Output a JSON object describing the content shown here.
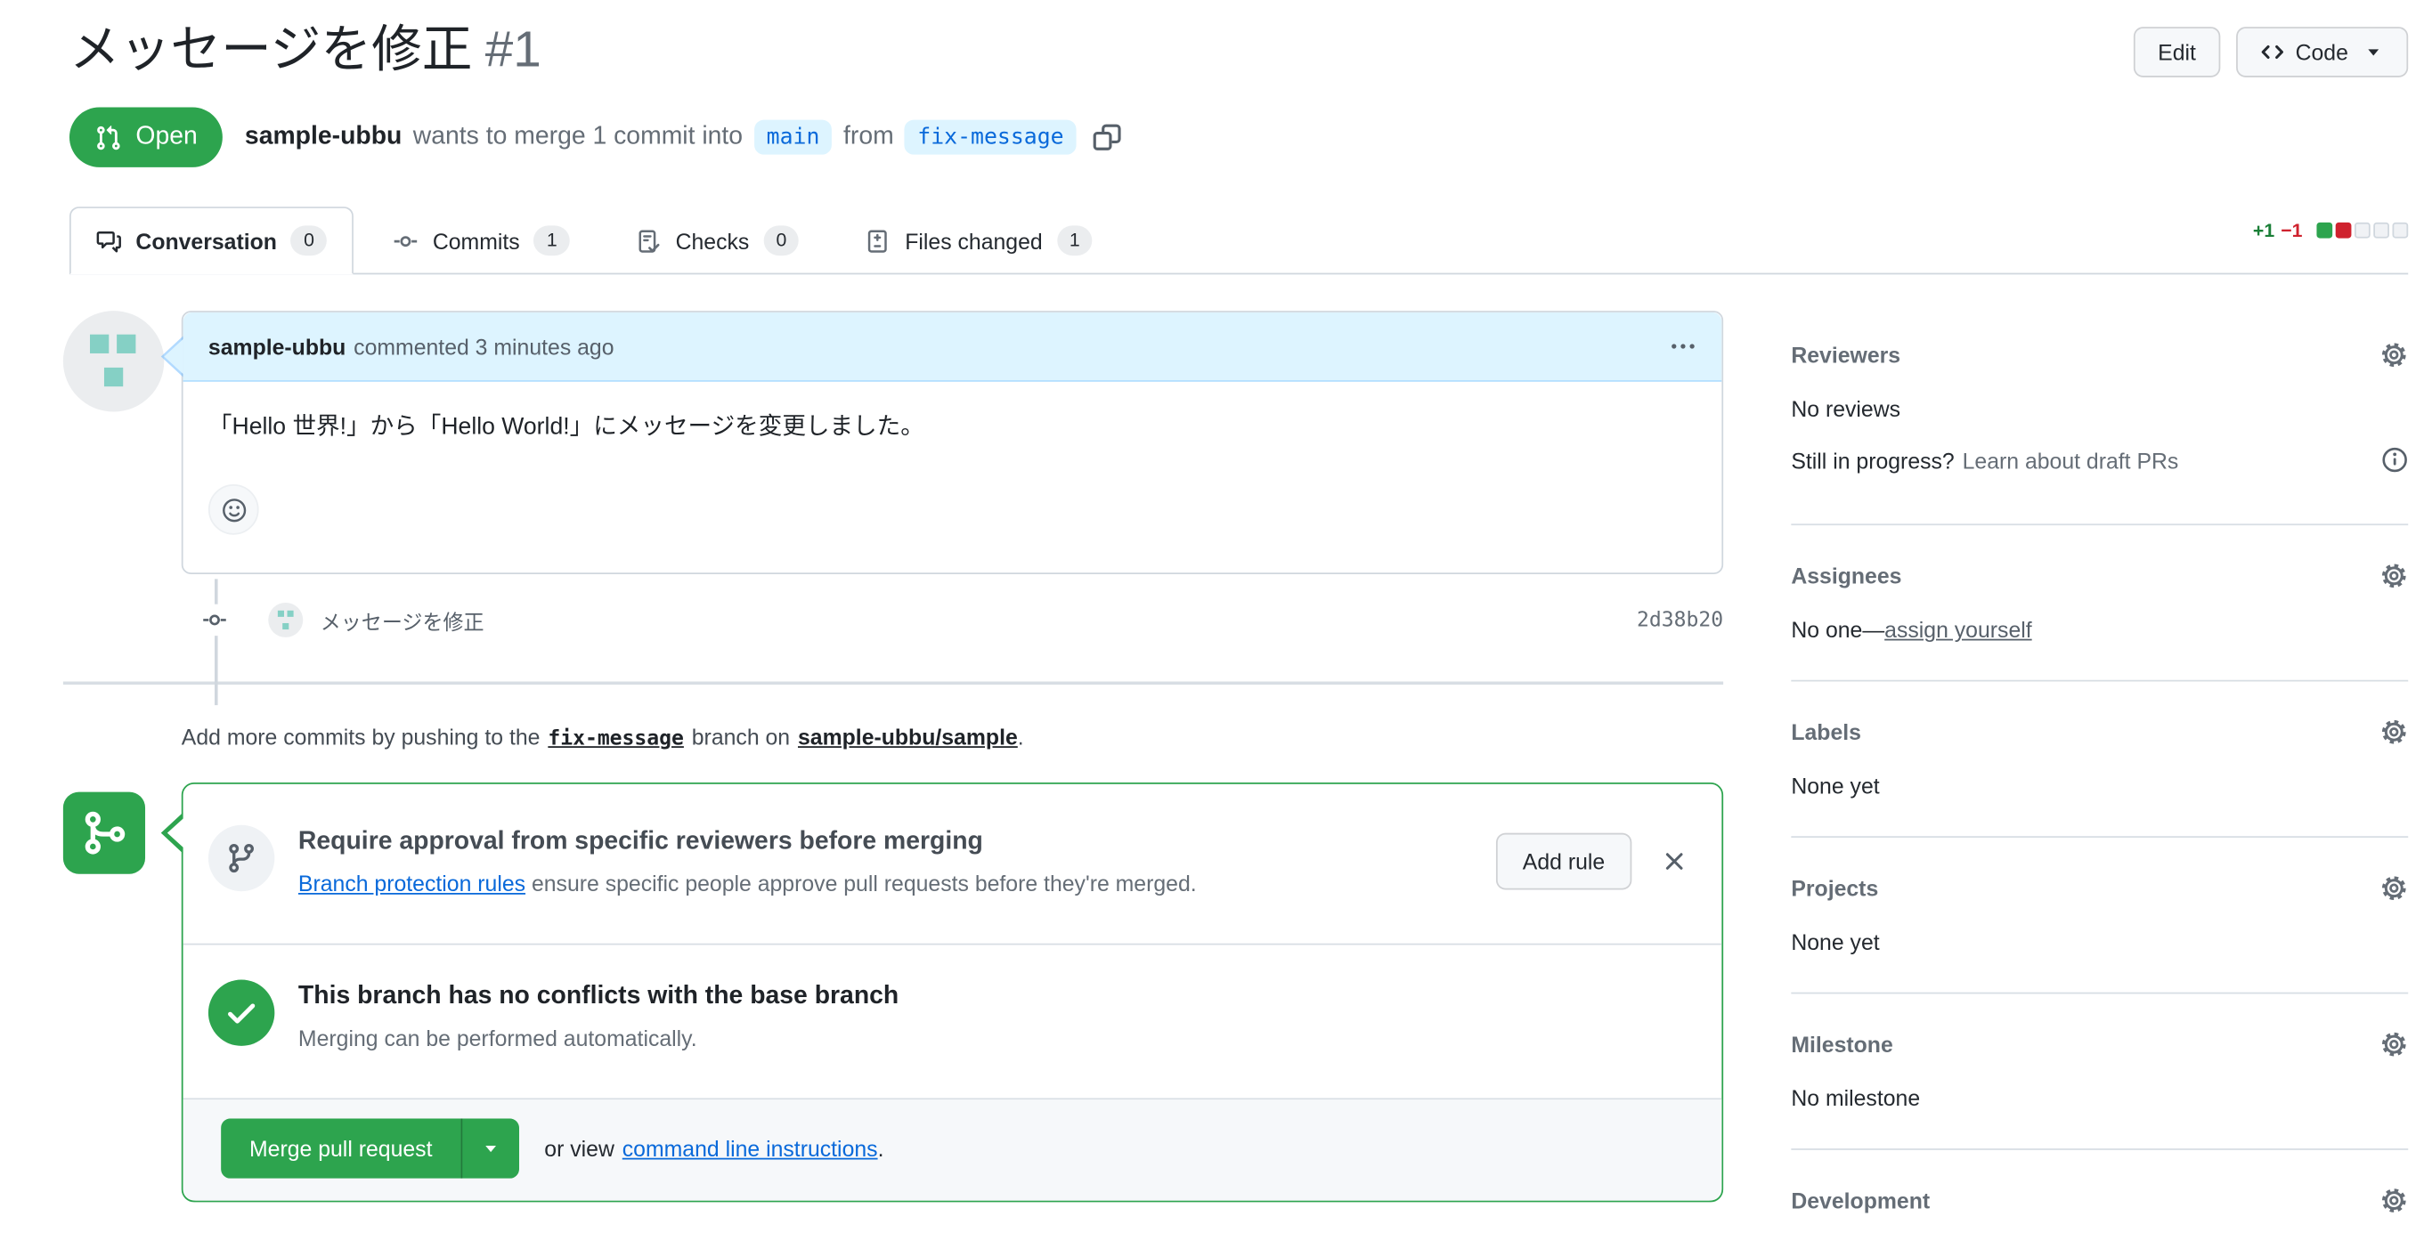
{
  "colors": {
    "open_green": "#2da44e",
    "link_blue": "#0969da",
    "addition_green": "#1a7f37",
    "deletion_red": "#cf222e",
    "branch_chip_bg": "#ddf4ff",
    "comment_header_bg": "#ddf4ff",
    "identicon_teal": "#85d0c5"
  },
  "icons": {
    "state": "git-pull-request",
    "code_button": "code",
    "dropdown": "triangle-down",
    "tab_conversation": "comment-discussion",
    "tab_commits": "git-commit",
    "tab_checks": "checklist",
    "tab_files": "file-diff",
    "copy": "copy",
    "comment_menu": "kebab-horizontal",
    "reaction": "smiley",
    "timeline_commit": "git-commit",
    "merge_badge": "git-merge",
    "branch_protection": "git-branch",
    "merge_check": "check",
    "close": "x",
    "section_settings": "gear",
    "draft_info": "info"
  },
  "header": {
    "title": "メッセージを修正",
    "number": "#1",
    "edit_label": "Edit",
    "code_label": "Code"
  },
  "meta": {
    "state": "Open",
    "author": "sample-ubbu",
    "action": "wants to merge 1 commit into",
    "base_branch": "main",
    "from_word": "from",
    "head_branch": "fix-message"
  },
  "tabs": [
    {
      "label": "Conversation",
      "count": "0"
    },
    {
      "label": "Commits",
      "count": "1"
    },
    {
      "label": "Checks",
      "count": "0"
    },
    {
      "label": "Files changed",
      "count": "1"
    }
  ],
  "diffstat": {
    "additions": "+1",
    "deletions": "−1"
  },
  "comment": {
    "author": "sample-ubbu",
    "meta": "commented 3 minutes ago",
    "body": "「Hello 世界!」から「Hello World!」にメッセージを変更しました。"
  },
  "commit": {
    "message": "メッセージを修正",
    "sha": "2d38b20"
  },
  "push_note": {
    "prefix": "Add more commits by pushing to the",
    "branch": "fix-message",
    "middle": "branch on",
    "repo": "sample-ubbu/sample",
    "suffix": "."
  },
  "merge_box": {
    "rule_title": "Require approval from specific reviewers before merging",
    "rule_link": "Branch protection rules",
    "rule_rest": "ensure specific people approve pull requests before they're merged.",
    "add_rule_label": "Add rule",
    "status_title": "This branch has no conflicts with the base branch",
    "status_subtitle": "Merging can be performed automatically.",
    "merge_button_label": "Merge pull request",
    "or_view": "or view",
    "cli_link": "command line instructions",
    "period": "."
  },
  "sidebar": {
    "sections": [
      {
        "title": "Reviewers",
        "body": "No reviews",
        "note_prefix": "Still in progress?",
        "note_link": "Learn about draft PRs"
      },
      {
        "title": "Assignees",
        "body_prefix": "No one—",
        "body_link": "assign yourself"
      },
      {
        "title": "Labels",
        "body": "None yet"
      },
      {
        "title": "Projects",
        "body": "None yet"
      },
      {
        "title": "Milestone",
        "body": "No milestone"
      },
      {
        "title": "Development"
      }
    ]
  }
}
